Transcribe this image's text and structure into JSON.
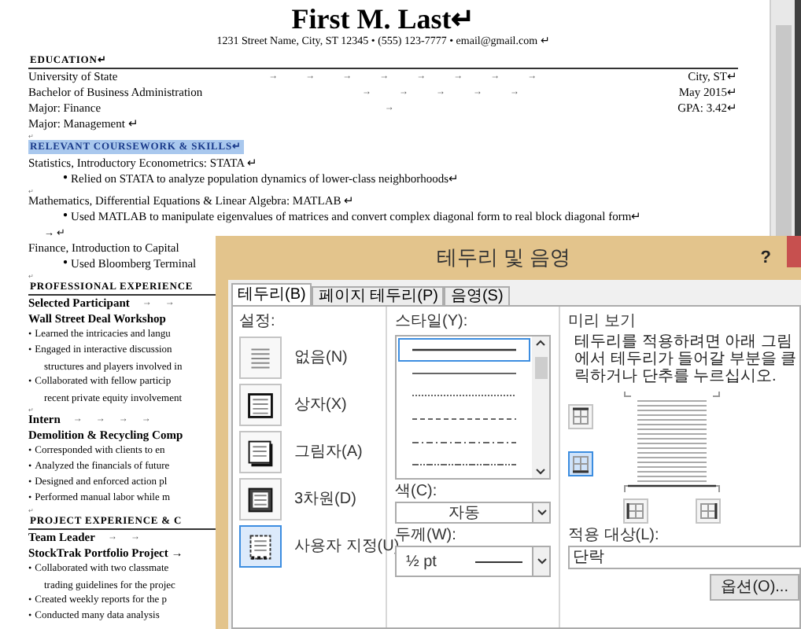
{
  "document": {
    "lines": [
      {
        "kind": "title",
        "text": "First M. Last↵"
      },
      {
        "kind": "contact",
        "text": "1231 Street Name, City, ST 12345 • (555) 123-7777 • email@gmail.com ↵"
      },
      {
        "kind": "heading",
        "text": "EDUCATION↵",
        "ruled": true,
        "highlighted": false
      },
      {
        "kind": "entry",
        "left": "University of State",
        "marks": "→ → → → → → → →",
        "right": "City, ST↵"
      },
      {
        "kind": "entry",
        "left": "Bachelor of Business Administration",
        "marks": "→ → → → →",
        "right": "May 2015↵"
      },
      {
        "kind": "entry",
        "left": "Major: Finance",
        "marks": "→",
        "right": "GPA: 3.42↵"
      },
      {
        "kind": "entry",
        "left": "Major: Management ↵"
      },
      {
        "kind": "mark",
        "text": "↵"
      },
      {
        "kind": "heading",
        "text": "RELEVANT COURSEWORK & SKILLS↵",
        "ruled": false,
        "highlighted": true
      },
      {
        "kind": "text",
        "text": "Statistics, Introductory Econometrics: STATA ↵"
      },
      {
        "kind": "bullet",
        "bullet": "●",
        "text": "Relied on STATA to analyze population dynamics of lower-class neighborhoods↵"
      },
      {
        "kind": "mark",
        "text": "↵"
      },
      {
        "kind": "text",
        "text": "Mathematics, Differential Equations & Linear Algebra: MATLAB ↵"
      },
      {
        "kind": "bullet",
        "bullet": "●",
        "text": "Used MATLAB to manipulate eigenvalues of matrices and convert complex diagonal form to real block diagonal form↵"
      },
      {
        "kind": "cont",
        "text": "→ ↵"
      },
      {
        "kind": "text",
        "text": "Finance, Introduction to Capital"
      },
      {
        "kind": "bullet",
        "bullet": "●",
        "text": "Used Bloomberg Terminal"
      },
      {
        "kind": "mark",
        "text": "↵"
      },
      {
        "kind": "heading",
        "text": "PROFESSIONAL EXPERIENCE",
        "ruled": true,
        "highlighted": false
      },
      {
        "kind": "role",
        "left": "Selected Participant",
        "marks": "→ →"
      },
      {
        "kind": "org",
        "text": "Wall Street Deal Workshop"
      },
      {
        "kind": "item",
        "bullet": "•",
        "text": "Learned the intricacies and langu"
      },
      {
        "kind": "item",
        "bullet": "•",
        "text": "Engaged in interactive discussion"
      },
      {
        "kind": "cont",
        "text": "structures and players involved in"
      },
      {
        "kind": "item",
        "bullet": "•",
        "text": "Collaborated with fellow particip"
      },
      {
        "kind": "cont",
        "text": "recent private equity involvement"
      },
      {
        "kind": "mark",
        "text": "↵"
      },
      {
        "kind": "role",
        "left": "Intern",
        "marks": "→ → → →"
      },
      {
        "kind": "org",
        "text": "Demolition & Recycling Comp"
      },
      {
        "kind": "item",
        "bullet": "•",
        "text": "Corresponded with clients to en"
      },
      {
        "kind": "item",
        "bullet": "•",
        "text": "Analyzed the financials of future"
      },
      {
        "kind": "item",
        "bullet": "•",
        "text": "Designed and enforced action pl"
      },
      {
        "kind": "item",
        "bullet": "•",
        "text": "Performed manual labor while m"
      },
      {
        "kind": "mark",
        "text": "↵"
      },
      {
        "kind": "heading",
        "text": "PROJECT EXPERIENCE & C",
        "ruled": true,
        "highlighted": false
      },
      {
        "kind": "role",
        "left": "Team Leader",
        "marks": "→ →"
      },
      {
        "kind": "org",
        "text": "StockTrak Portfolio Project →"
      },
      {
        "kind": "item",
        "bullet": "•",
        "text": "Collaborated with two classmate"
      },
      {
        "kind": "cont",
        "text": "trading guidelines for the projec"
      },
      {
        "kind": "item",
        "bullet": "•",
        "text": "Created weekly reports for the p"
      },
      {
        "kind": "item",
        "bullet": "•",
        "text": "Conducted many data analysis"
      }
    ]
  },
  "dialog": {
    "title": "테두리 및 음영",
    "help": "?",
    "tabs": [
      {
        "label": "테두리(B)",
        "selected": true
      },
      {
        "label": "페이지 테두리(P)",
        "selected": false
      },
      {
        "label": "음영(S)",
        "selected": false
      }
    ],
    "settings": {
      "label": "설정:",
      "options": [
        {
          "kind": "none",
          "label": "없음(N)",
          "selected": false
        },
        {
          "kind": "box",
          "label": "상자(X)",
          "selected": false
        },
        {
          "kind": "shadow",
          "label": "그림자(A)",
          "selected": false
        },
        {
          "kind": "threed",
          "label": "3차원(D)",
          "selected": false
        },
        {
          "kind": "custom",
          "label": "사용자 지정(U)",
          "selected": true
        }
      ]
    },
    "style": {
      "label": "스타일(Y):",
      "options": [
        {
          "kind": "solid",
          "selected": true
        },
        {
          "kind": "thin",
          "selected": false
        },
        {
          "kind": "dotted",
          "selected": false
        },
        {
          "kind": "dashed",
          "selected": false
        },
        {
          "kind": "dashdot",
          "selected": false
        },
        {
          "kind": "dashdotdot",
          "selected": false
        }
      ]
    },
    "color": {
      "label": "색(C):",
      "value": "자동"
    },
    "width": {
      "label": "두께(W):",
      "value": "½ pt"
    },
    "preview": {
      "label": "미리 보기",
      "hint": "테두리를 적용하려면 아래 그림에서 테두리가 들어갈 부분을 클릭하거나 단추를 누르십시오.",
      "buttons": [
        {
          "kind": "top",
          "selected": false
        },
        {
          "kind": "bottom",
          "selected": true
        },
        {
          "kind": "left",
          "selected": false
        },
        {
          "kind": "right",
          "selected": false
        }
      ]
    },
    "apply_to": {
      "label": "적용 대상(L):",
      "value": "단락"
    },
    "options_button": "옵션(O)..."
  }
}
